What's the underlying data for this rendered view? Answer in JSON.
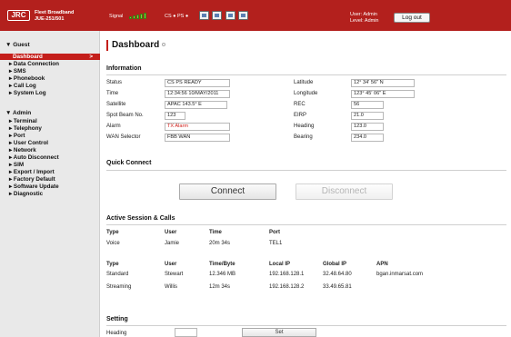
{
  "header": {
    "logo": "JRC",
    "product_line1": "Fleet Broadband",
    "product_line2": "JUE-251/501",
    "signal_label": "Signal",
    "signal_level": 5,
    "signal_max": 5,
    "status_text": "CS ● PS ●",
    "user_line": "User: Admin",
    "level_line": "Level: Admin",
    "logout_label": "Log out",
    "icons": [
      "mail-icon",
      "printer-icon",
      "network-icon",
      "phone-icon"
    ]
  },
  "sidebar": {
    "guest_label": "▼ Guest",
    "guest_items": [
      {
        "label": "Dashboard",
        "active": true
      },
      {
        "label": "▸ Data Connection"
      },
      {
        "label": "▸ SMS"
      },
      {
        "label": "▸ Phonebook"
      },
      {
        "label": "▸ Call Log"
      },
      {
        "label": "▸ System Log"
      }
    ],
    "active_chevron": ">",
    "admin_label": "▼ Admin",
    "admin_items": [
      {
        "label": "▸ Terminal"
      },
      {
        "label": "▸ Telephony"
      },
      {
        "label": "▸ Port"
      },
      {
        "label": "▸ User Control"
      },
      {
        "label": "▸ Network"
      },
      {
        "label": "▸ Auto Disconnect"
      },
      {
        "label": "▸ SIM"
      },
      {
        "label": "▸ Export / Import"
      },
      {
        "label": "▸ Factory Default"
      },
      {
        "label": "▸ Software Update"
      },
      {
        "label": "▸ Diagnostic"
      }
    ]
  },
  "main": {
    "title": "Dashboard",
    "information": {
      "heading": "Information",
      "left": [
        {
          "label": "Status",
          "value": "CS PS READY"
        },
        {
          "label": "Time",
          "value": "12:34:56 10/MAY/2011"
        },
        {
          "label": "Satellite",
          "value": "APAC 143.5° E"
        },
        {
          "label": "Spot Beam No.",
          "value": "123"
        },
        {
          "label": "Alarm",
          "value": "TX Alarm",
          "alarm": true
        },
        {
          "label": "WAN Selector",
          "value": "FBB WAN"
        }
      ],
      "right": [
        {
          "label": "Latitude",
          "value": "12° 34' 56\" N"
        },
        {
          "label": "Longitude",
          "value": "123° 45' 06\" E"
        },
        {
          "label": "REC",
          "value": "56"
        },
        {
          "label": "EIRP",
          "value": "21.0"
        },
        {
          "label": "Heading",
          "value": "123.0"
        },
        {
          "label": "Bearing",
          "value": "234.0"
        }
      ]
    },
    "quick_connect": {
      "heading": "Quick Connect",
      "connect_label": "Connect",
      "disconnect_label": "Disconnect"
    },
    "sessions": {
      "heading": "Active Session & Calls",
      "voice_headers": [
        "Type",
        "User",
        "Time",
        "Port"
      ],
      "voice_rows": [
        [
          "Voice",
          "Jamie",
          "20m 34s",
          "TEL1"
        ]
      ],
      "data_headers": [
        "Type",
        "User",
        "Time/Byte",
        "Local IP",
        "Global IP",
        "APN"
      ],
      "data_rows": [
        [
          "Standard",
          "Stewart",
          "12.346 MB",
          "192.168.128.1",
          "32.48.64.80",
          "bgan.inmarsat.com"
        ],
        [
          "Streaming",
          "Willis",
          "12m 34s",
          "192.168.128.2",
          "33.49.65.81",
          ""
        ]
      ]
    },
    "setting": {
      "heading": "Setting",
      "heading_label": "Heading",
      "set_label": "Set"
    }
  },
  "colors": {
    "brand_red": "#b3201d",
    "active_red": "#c41e1a",
    "signal_green": "#7ed13a"
  }
}
